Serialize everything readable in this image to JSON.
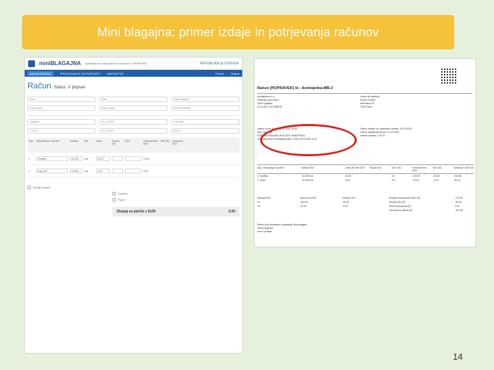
{
  "slide": {
    "title": "Mini blagajna; primer izdaje in potrjevanja računov",
    "page_number": "14"
  },
  "app": {
    "logo_prefix": "mini",
    "logo_name": "BLAGAJNA",
    "logo_sub": "Aplikacija za izdajo potrdil in računov z VERPOMO",
    "gov_label": "REPUBLIKA SLOVENIJA",
    "nav": [
      "IZDAJA RAČUNA",
      "PREGLEDANJE VIH RAČUNOV",
      "NASTAVITVE"
    ],
    "nav_right": [
      "Pomoč",
      "Odjava"
    ],
    "page_title": "Račun",
    "page_status": "Status: V pripravi",
    "fields_row1": [
      "Izbira",
      "Izbira",
      "Izbira blagajne"
    ],
    "fields_row2": [
      "Vrsta kupca",
      "Način plačila",
      "Davčna številka"
    ],
    "fields_row3": [
      "Ljubljana",
      "16.12.2015",
      "1234 Zelo"
    ],
    "fields_row4": [
      "1.10.20",
      "24.12.2015",
      "SDU IT"
    ],
    "table_headers": [
      "Zap.",
      "Artikel/Naziv / storitev",
      "Količina",
      "EM",
      "Cena",
      "Popust (%)",
      "DDV",
      "Vrednost brez DDV",
      "DDV (€)",
      "Vrednost z DDV",
      ""
    ],
    "rows": [
      [
        "1",
        "Svetilka",
        "10,000",
        "kos",
        "24,00",
        "",
        "",
        "24,00",
        "",
        "",
        ""
      ],
      [
        "2",
        "Kapa 28",
        "10,000",
        "kos",
        "3,20",
        "",
        "",
        "3,20",
        "",
        "",
        ""
      ]
    ],
    "check_label": "Obrnjen znesek",
    "options": [
      "Gotovina",
      "Plačilo"
    ],
    "pay_label": "Skupaj za plačilo v EUR:",
    "pay_value": "0,00"
  },
  "document": {
    "title": "Račun [POPRAVEK] št.: Avtotajnika-MB-2",
    "seller_lines": [
      "Avtotajnika d.o.o.",
      "Velikega nosa ulica 2",
      "1000 Ljubljana",
      "ID za DDV: SI12345678"
    ],
    "buyer_lines": [
      "Kupec ali naročnik:",
      "Novak Gorazd",
      "Kamniška 18",
      "1234 Pekel"
    ],
    "meta_left": [
      "Datum in čas izdaje: 16.12.2015 12:45",
      "Kraj: Ljubljana",
      "EOR: ad57f23a-3f04-4015-9237-3c8a3f7f0011",
      "Popravlja račun: Avtotajnika-MB-2 z dne 16.12.2015 11:42"
    ],
    "meta_right": [
      "Datum dobave oz. opravljene storitve: 16.12.2015",
      "Datum zapadlosti računa: 24.12.2015",
      "Interna oznaka: 1-10-20"
    ],
    "table_headers": [
      "Zap. Vrsta blaga / storitve",
      "Količina EM",
      "Cena (€) brez DDV",
      "Popust (%)",
      "DDV (%)",
      "Vrednost brez DDV",
      "DDV (€)",
      "Vrednost z DDV (€)"
    ],
    "rows": [
      [
        "1. Svetilka",
        "-10,000 kos",
        "24,00",
        "",
        "22",
        "-240,00",
        "-52,80",
        "-292,80"
      ],
      [
        "2. Kapa",
        "-10,000 kos",
        "3,20",
        "",
        "9,5",
        "-32,00",
        "-3,04",
        "-35,04"
      ]
    ],
    "summary": [
      [
        "Stopnja DDV",
        "Osnova za DDV",
        "Znesek DDV",
        "Skupaj vrednost brez DDV (€)",
        "-272,00"
      ],
      [
        "22",
        "-240,00",
        "-52,80",
        "Skupaj DDV (€)",
        "-55,84"
      ],
      [
        "9,5",
        "-32,00",
        "-3,04",
        "Vrednost popusta (€)",
        "0,00"
      ],
      [
        "",
        "",
        "",
        "Vrednost za plačilo (€)",
        "-327,84"
      ]
    ],
    "footer": [
      "Račun je bil sestavljen z aplikacijo Mini blagajna.",
      "Račun pripravil:",
      "Ime in priimek"
    ]
  },
  "colors": {
    "banner": "#f6c23a",
    "background": "#e6f1dd",
    "nav": "#1f5fa8",
    "highlight": "#d8231e"
  }
}
